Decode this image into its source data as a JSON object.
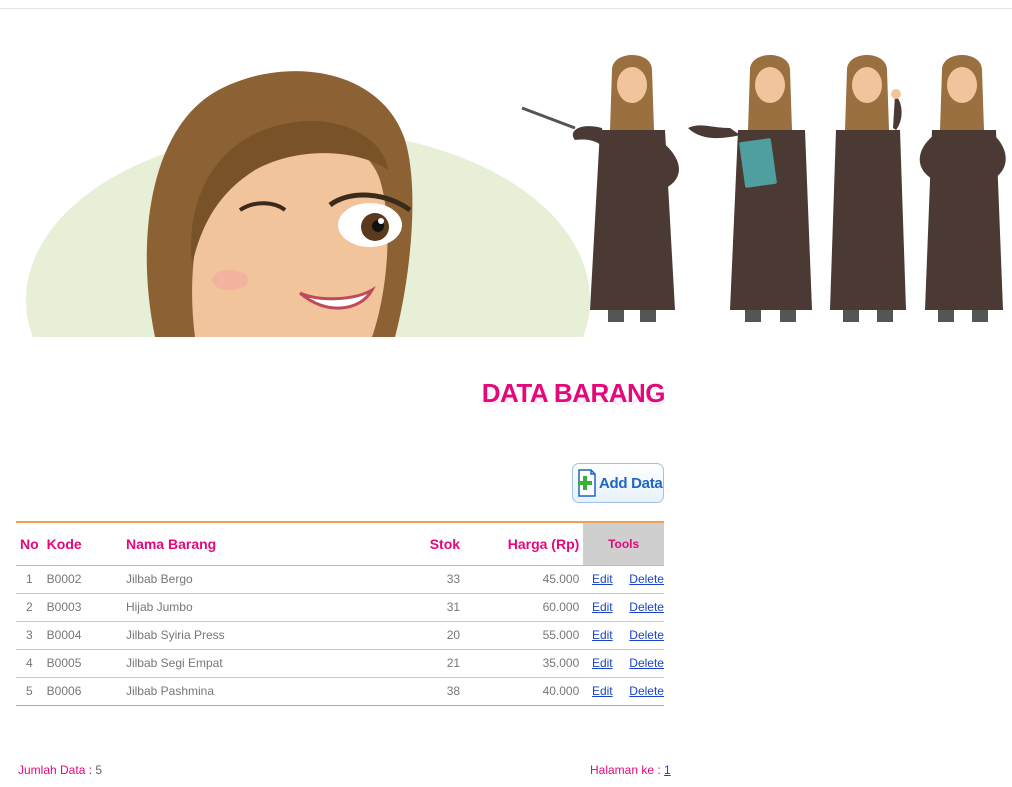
{
  "page": {
    "title": "DATA BARANG",
    "add_button_label": "Add Data"
  },
  "table": {
    "headers": {
      "no": "No",
      "kode": "Kode",
      "nama": "Nama Barang",
      "stok": "Stok",
      "harga": "Harga (Rp)",
      "tools": "Tools"
    },
    "action_labels": {
      "edit": "Edit",
      "delete": "Delete"
    },
    "rows": [
      {
        "no": "1",
        "kode": "B0002",
        "nama": "Jilbab Bergo",
        "stok": "33",
        "harga": "45.000"
      },
      {
        "no": "2",
        "kode": "B0003",
        "nama": "Hijab Jumbo",
        "stok": "31",
        "harga": "60.000"
      },
      {
        "no": "3",
        "kode": "B0004",
        "nama": "Jilbab Syiria Press",
        "stok": "20",
        "harga": "55.000"
      },
      {
        "no": "4",
        "kode": "B0005",
        "nama": "Jilbab Segi Empat",
        "stok": "21",
        "harga": "35.000"
      },
      {
        "no": "5",
        "kode": "B0006",
        "nama": "Jilbab Pashmina",
        "stok": "38",
        "harga": "40.000"
      }
    ]
  },
  "footer": {
    "total_label": "Jumlah Data :",
    "total_value": "5",
    "page_label": "Halaman ke :",
    "page_link": "1"
  },
  "colors": {
    "accent": "#e5087b",
    "link": "#1a44c8",
    "header_rule": "#f0a050",
    "tools_header_bg": "#cfcfcf"
  },
  "icons": {
    "add_button": "document-plus-icon"
  }
}
